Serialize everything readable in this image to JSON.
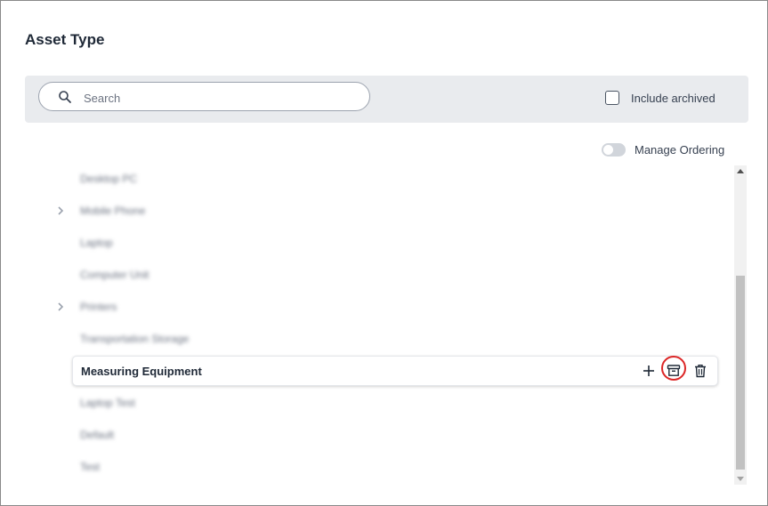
{
  "page": {
    "title": "Asset Type"
  },
  "filter": {
    "search_placeholder": "Search",
    "search_value": "",
    "include_archived_label": "Include archived",
    "include_archived_checked": false
  },
  "ordering": {
    "label": "Manage Ordering",
    "enabled": false
  },
  "tree": {
    "items": [
      {
        "label": "Desktop PC",
        "has_children": false,
        "blurred": true
      },
      {
        "label": "Mobile Phone",
        "has_children": true,
        "blurred": true
      },
      {
        "label": "Laptop",
        "has_children": false,
        "blurred": true
      },
      {
        "label": "Computer Unit",
        "has_children": false,
        "blurred": true
      },
      {
        "label": "Printers",
        "has_children": true,
        "blurred": true
      },
      {
        "label": "Transportation Storage",
        "has_children": false,
        "blurred": true
      },
      {
        "label": "Measuring Equipment",
        "has_children": false,
        "blurred": false,
        "selected": true
      },
      {
        "label": "Laptop Test",
        "has_children": false,
        "blurred": true
      },
      {
        "label": "Default",
        "has_children": false,
        "blurred": true
      },
      {
        "label": "Test",
        "has_children": false,
        "blurred": true
      }
    ],
    "selected_actions": [
      {
        "name": "add",
        "icon": "plus-icon"
      },
      {
        "name": "archive",
        "icon": "archive-icon",
        "highlighted": true
      },
      {
        "name": "delete",
        "icon": "trash-icon"
      }
    ]
  },
  "colors": {
    "highlight_ring": "#dc2626",
    "filter_bar_bg": "#e9ebee"
  }
}
